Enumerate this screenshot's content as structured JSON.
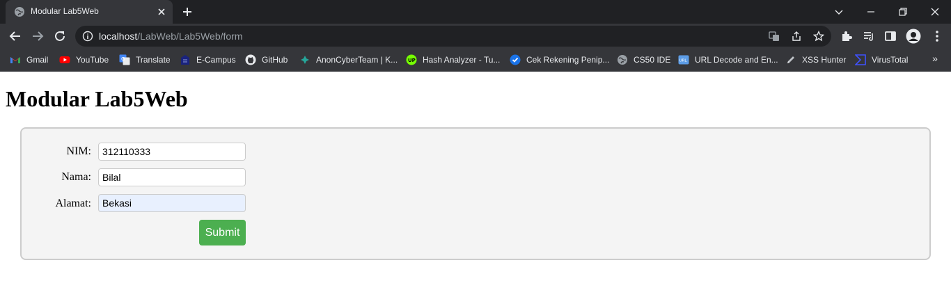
{
  "browser": {
    "tab": {
      "title": "Modular Lab5Web"
    },
    "address": {
      "host": "localhost",
      "path": "/LabWeb/Lab5Web/form"
    },
    "bookmarks": [
      {
        "label": "Gmail",
        "icon": "gmail-icon"
      },
      {
        "label": "YouTube",
        "icon": "youtube-icon"
      },
      {
        "label": "Translate",
        "icon": "translate-icon"
      },
      {
        "label": "E-Campus",
        "icon": "ecampus-icon"
      },
      {
        "label": "GitHub",
        "icon": "github-icon"
      },
      {
        "label": "AnonCyberTeam | K...",
        "icon": "anoncyberteam-icon"
      },
      {
        "label": "Hash Analyzer - Tu...",
        "icon": "hash-analyzer-icon"
      },
      {
        "label": "Cek Rekening Penip...",
        "icon": "check-badge-icon"
      },
      {
        "label": "CS50 IDE",
        "icon": "globe-icon"
      },
      {
        "label": "URL Decode and En...",
        "icon": "url-icon"
      },
      {
        "label": "XSS Hunter",
        "icon": "pen-icon"
      },
      {
        "label": "VirusTotal",
        "icon": "virustotal-icon"
      }
    ],
    "more_bookmarks": "»"
  },
  "page": {
    "title": "Modular Lab5Web",
    "form": {
      "fields": [
        {
          "label": "NIM:",
          "value": "312110333"
        },
        {
          "label": "Nama:",
          "value": "Bilal"
        },
        {
          "label": "Alamat:",
          "value": "Bekasi"
        }
      ],
      "submit_label": "Submit"
    }
  },
  "colors": {
    "chrome_dark": "#202124",
    "chrome_toolbar": "#35363a",
    "submit_green": "#4caf50",
    "form_background": "#f4f4f4",
    "autofill_blue": "#e8f0fe"
  }
}
